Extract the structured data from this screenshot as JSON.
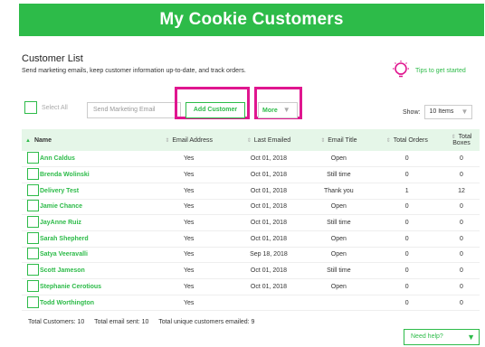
{
  "header": {
    "title": "My Cookie Customers"
  },
  "list": {
    "title": "Customer List",
    "subtitle": "Send marketing emails, keep customer information up-to-date, and track orders."
  },
  "tips": {
    "label": "Tips to get started",
    "icon": "lightbulb-icon",
    "color": "#e0168f"
  },
  "toolbar": {
    "select_all": "Select All",
    "send_email": "Send Marketing Email",
    "add_customer": "Add Customer",
    "more": "More",
    "show_label": "Show:",
    "show_value": "10 Items"
  },
  "table": {
    "columns": [
      "Name",
      "Email Address",
      "Last Emailed",
      "Email Title",
      "Total Orders",
      "Total Boxes"
    ],
    "rows": [
      {
        "name": "Ann Caldus",
        "email": "Yes",
        "last": "Oct 01, 2018",
        "title": "Open",
        "orders": "0",
        "boxes": "0"
      },
      {
        "name": "Brenda Wolinski",
        "email": "Yes",
        "last": "Oct 01, 2018",
        "title": "Still time",
        "orders": "0",
        "boxes": "0"
      },
      {
        "name": "Delivery Test",
        "email": "Yes",
        "last": "Oct 01, 2018",
        "title": "Thank you",
        "orders": "1",
        "boxes": "12"
      },
      {
        "name": "Jamie Chance",
        "email": "Yes",
        "last": "Oct 01, 2018",
        "title": "Open",
        "orders": "0",
        "boxes": "0"
      },
      {
        "name": "JayAnne Ruiz",
        "email": "Yes",
        "last": "Oct 01, 2018",
        "title": "Still time",
        "orders": "0",
        "boxes": "0"
      },
      {
        "name": "Sarah Shepherd",
        "email": "Yes",
        "last": "Oct 01, 2018",
        "title": "Open",
        "orders": "0",
        "boxes": "0"
      },
      {
        "name": "Satya Veeravalli",
        "email": "Yes",
        "last": "Sep 18, 2018",
        "title": "Open",
        "orders": "0",
        "boxes": "0"
      },
      {
        "name": "Scott Jameson",
        "email": "Yes",
        "last": "Oct 01, 2018",
        "title": "Still time",
        "orders": "0",
        "boxes": "0"
      },
      {
        "name": "Stephanie Cerotious",
        "email": "Yes",
        "last": "Oct 01, 2018",
        "title": "Open",
        "orders": "0",
        "boxes": "0"
      },
      {
        "name": "Todd Worthington",
        "email": "Yes",
        "last": "",
        "title": "",
        "orders": "0",
        "boxes": "0"
      }
    ]
  },
  "footer": {
    "total_customers": "Total Customers: 10",
    "total_email_sent": "Total email sent: 10",
    "total_unique": "Total unique customers emailed: 9"
  },
  "help": {
    "label": "Need help?"
  },
  "colors": {
    "brand_green": "#2dbb49",
    "highlight": "#e0168f",
    "header_row": "#e5f6e8"
  }
}
